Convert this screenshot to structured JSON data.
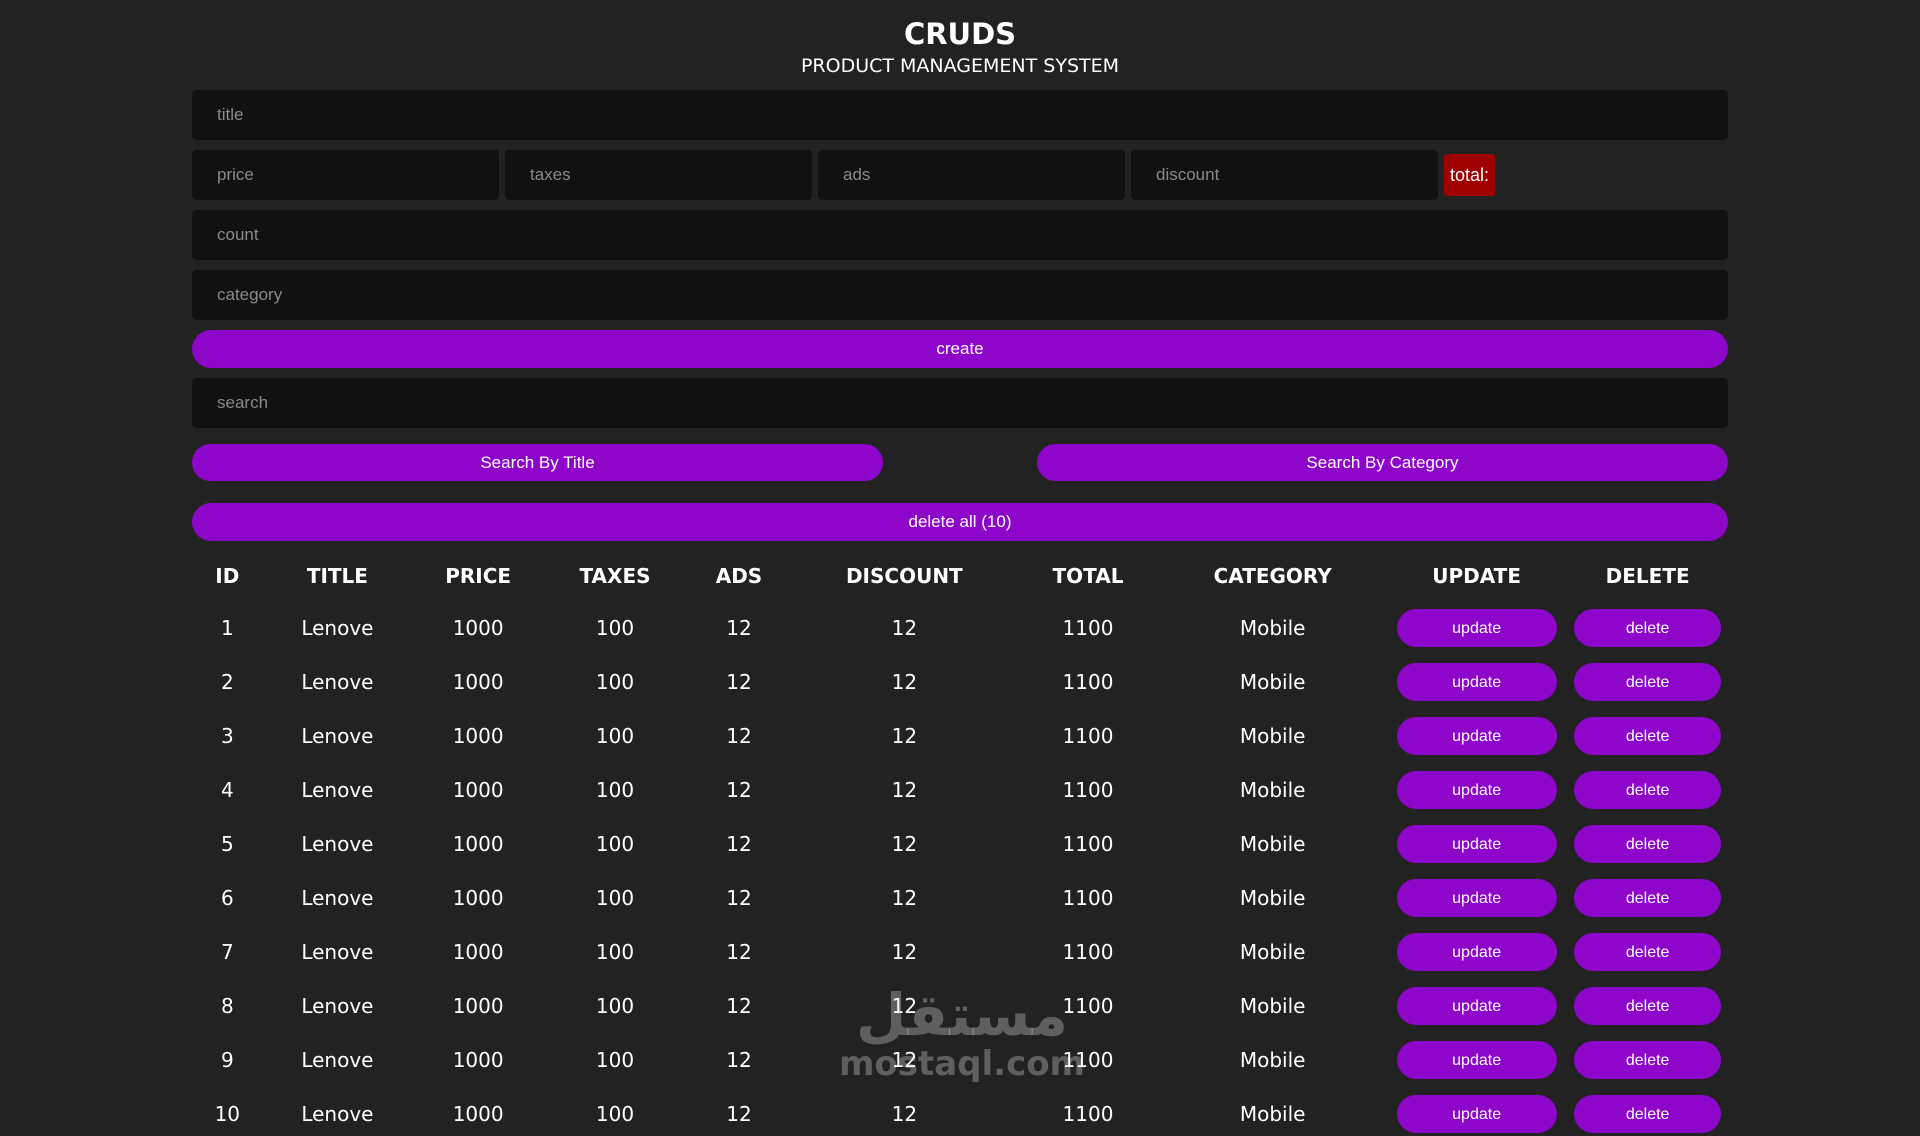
{
  "header": {
    "title": "CRUDS",
    "subtitle": "PRODUCT MANAGEMENT SYSTEM"
  },
  "form": {
    "title_placeholder": "title",
    "price_placeholder": "price",
    "taxes_placeholder": "taxes",
    "ads_placeholder": "ads",
    "discount_placeholder": "discount",
    "total_label": "total:",
    "count_placeholder": "count",
    "category_placeholder": "category",
    "create_label": "create",
    "search_placeholder": "search",
    "search_title_label": "Search By Title",
    "search_category_label": "Search By Category",
    "delete_all_label": "delete all (10)"
  },
  "table": {
    "headers": [
      "ID",
      "TITLE",
      "PRICE",
      "TAXES",
      "ADS",
      "DISCOUNT",
      "TOTAL",
      "CATEGORY",
      "UPDATE",
      "DELETE"
    ],
    "update_label": "update",
    "delete_label": "delete",
    "rows": [
      {
        "id": "1",
        "title": "Lenove",
        "price": "1000",
        "taxes": "100",
        "ads": "12",
        "discount": "12",
        "total": "1100",
        "category": "Mobile"
      },
      {
        "id": "2",
        "title": "Lenove",
        "price": "1000",
        "taxes": "100",
        "ads": "12",
        "discount": "12",
        "total": "1100",
        "category": "Mobile"
      },
      {
        "id": "3",
        "title": "Lenove",
        "price": "1000",
        "taxes": "100",
        "ads": "12",
        "discount": "12",
        "total": "1100",
        "category": "Mobile"
      },
      {
        "id": "4",
        "title": "Lenove",
        "price": "1000",
        "taxes": "100",
        "ads": "12",
        "discount": "12",
        "total": "1100",
        "category": "Mobile"
      },
      {
        "id": "5",
        "title": "Lenove",
        "price": "1000",
        "taxes": "100",
        "ads": "12",
        "discount": "12",
        "total": "1100",
        "category": "Mobile"
      },
      {
        "id": "6",
        "title": "Lenove",
        "price": "1000",
        "taxes": "100",
        "ads": "12",
        "discount": "12",
        "total": "1100",
        "category": "Mobile"
      },
      {
        "id": "7",
        "title": "Lenove",
        "price": "1000",
        "taxes": "100",
        "ads": "12",
        "discount": "12",
        "total": "1100",
        "category": "Mobile"
      },
      {
        "id": "8",
        "title": "Lenove",
        "price": "1000",
        "taxes": "100",
        "ads": "12",
        "discount": "12",
        "total": "1100",
        "category": "Mobile"
      },
      {
        "id": "9",
        "title": "Lenove",
        "price": "1000",
        "taxes": "100",
        "ads": "12",
        "discount": "12",
        "total": "1100",
        "category": "Mobile"
      },
      {
        "id": "10",
        "title": "Lenove",
        "price": "1000",
        "taxes": "100",
        "ads": "12",
        "discount": "12",
        "total": "1100",
        "category": "Mobile"
      }
    ]
  },
  "watermark": {
    "arabic": "مستقل",
    "latin": "mostaql.com"
  },
  "colors": {
    "background": "#222222",
    "field": "#111111",
    "accent": "#8e06c9",
    "total_badge": "#a00000"
  }
}
